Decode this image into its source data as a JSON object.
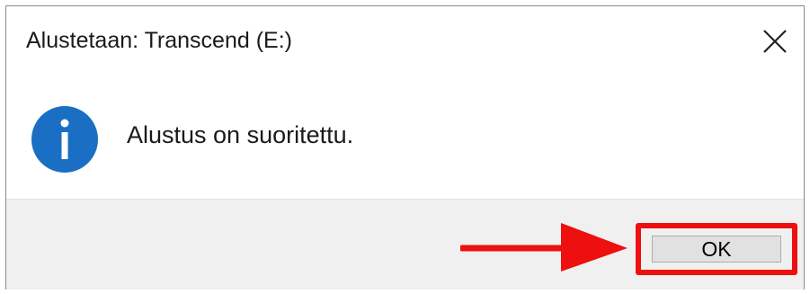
{
  "dialog": {
    "title": "Alustetaan: Transcend (E:)",
    "message": "Alustus on suoritettu.",
    "ok_label": "OK",
    "icons": {
      "close": "close-icon",
      "info": "info-icon",
      "arrow": "arrow-right-icon"
    }
  },
  "colors": {
    "info_blue": "#1a6fc4",
    "highlight_red": "#ee0f0f",
    "footer_bg": "#f0f0f0",
    "button_bg": "#e1e1e1"
  }
}
